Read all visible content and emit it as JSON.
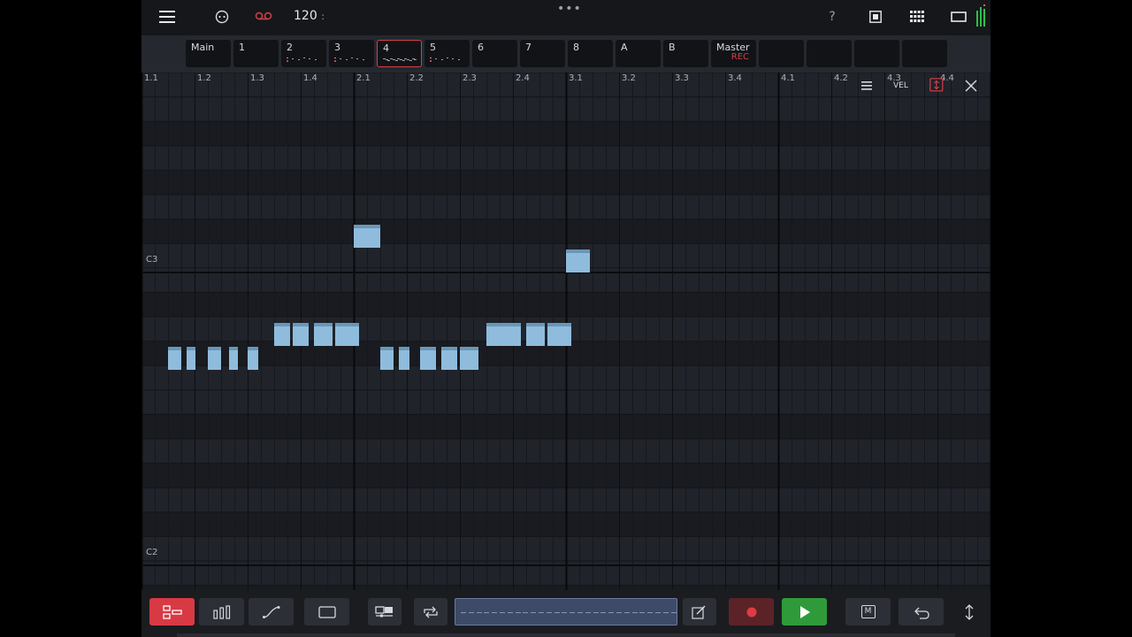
{
  "topbar": {
    "icons": [
      "menu-icon",
      "connection-icon",
      "tape-record-icon",
      "help-icon",
      "stop-square-icon",
      "grid-apps-icon",
      "window-icon",
      "level-meter-icon"
    ],
    "tempo": "120",
    "tempo_suffix": ":",
    "help_label": "?",
    "more_label": "•••"
  },
  "patterns": [
    {
      "label": "Main",
      "sub": "",
      "selected": false
    },
    {
      "label": "1",
      "sub": "",
      "selected": false
    },
    {
      "label": "2",
      "sub": "",
      "selected": false
    },
    {
      "label": "3",
      "sub": "",
      "selected": false
    },
    {
      "label": "4",
      "sub": "",
      "selected": true
    },
    {
      "label": "5",
      "sub": "",
      "selected": false
    },
    {
      "label": "6",
      "sub": "",
      "selected": false
    },
    {
      "label": "7",
      "sub": "",
      "selected": false
    },
    {
      "label": "8",
      "sub": "",
      "selected": false
    },
    {
      "label": "A",
      "sub": "",
      "selected": false
    },
    {
      "label": "B",
      "sub": "",
      "selected": false
    },
    {
      "label": "Master",
      "sub": "REC",
      "selected": false
    },
    {
      "label": "",
      "sub": "",
      "selected": false
    },
    {
      "label": "",
      "sub": "",
      "selected": false
    },
    {
      "label": "",
      "sub": "",
      "selected": false
    },
    {
      "label": "",
      "sub": "",
      "selected": false
    }
  ],
  "ruler": [
    "1.1",
    "1.2",
    "1.3",
    "1.4",
    "2.1",
    "2.2",
    "2.3",
    "2.4",
    "3.1",
    "3.2",
    "3.3",
    "3.4",
    "4.1",
    "4.2",
    "4.3",
    "4.4"
  ],
  "pitch_labels": {
    "top": "C3",
    "bottom": "C2"
  },
  "grid_tools": {
    "menu_icon": "list-icon",
    "vel_label": "VEL",
    "resize_icon": "vertical-resize-icon",
    "close_icon": "close-icon"
  },
  "notes": [
    {
      "pitch": "A2",
      "beat": 0.25,
      "length": 0.25
    },
    {
      "pitch": "A2",
      "beat": 0.6,
      "length": 0.15
    },
    {
      "pitch": "A2",
      "beat": 1.0,
      "length": 0.25
    },
    {
      "pitch": "A2",
      "beat": 1.4,
      "length": 0.15
    },
    {
      "pitch": "A2",
      "beat": 1.75,
      "length": 0.2
    },
    {
      "pitch": "A#2",
      "beat": 2.25,
      "length": 0.3
    },
    {
      "pitch": "A#2",
      "beat": 2.6,
      "length": 0.3
    },
    {
      "pitch": "A#2",
      "beat": 3.0,
      "length": 0.35
    },
    {
      "pitch": "A#2",
      "beat": 3.4,
      "length": 0.45
    },
    {
      "pitch": "D3",
      "beat": 3.75,
      "length": 0.5
    },
    {
      "pitch": "A2",
      "beat": 4.25,
      "length": 0.25
    },
    {
      "pitch": "A2",
      "beat": 4.6,
      "length": 0.2
    },
    {
      "pitch": "A2",
      "beat": 5.0,
      "length": 0.3
    },
    {
      "pitch": "A2",
      "beat": 5.4,
      "length": 0.3
    },
    {
      "pitch": "A2",
      "beat": 5.75,
      "length": 0.35
    },
    {
      "pitch": "A#2",
      "beat": 6.25,
      "length": 0.35
    },
    {
      "pitch": "A#2",
      "beat": 6.6,
      "length": 0.3
    },
    {
      "pitch": "A#2",
      "beat": 7.0,
      "length": 0.35
    },
    {
      "pitch": "A#2",
      "beat": 7.4,
      "length": 0.45
    },
    {
      "pitch": "C#3",
      "beat": 7.75,
      "length": 0.45
    }
  ],
  "bottombar": {
    "icons": [
      "pattern-mode-icon",
      "velocity-bars-icon",
      "automation-curve-icon",
      "selection-box-icon",
      "clip-view-icon",
      "loop-icon",
      "edit-pencil-icon",
      "record-icon",
      "play-icon",
      "metronome-icon",
      "undo-icon",
      "expand-vertical-icon"
    ],
    "metronome_label": "M"
  },
  "colors": {
    "accent_red": "#d83a44",
    "play_green": "#2f9a3a",
    "note_blue": "#8fbcdc",
    "background": "#1d2025"
  }
}
